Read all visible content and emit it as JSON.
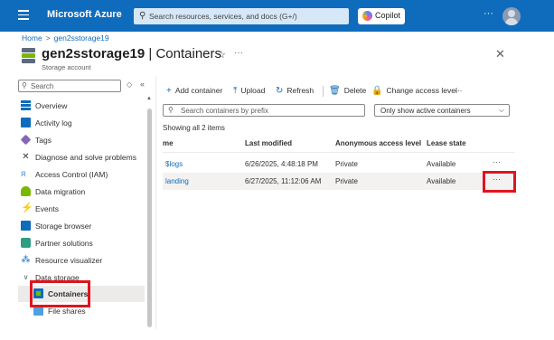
{
  "topbar": {
    "brand": "Microsoft Azure",
    "search_placeholder": "Search resources, services, and docs (G+/)",
    "copilot_label": "Copilot",
    "more": "···"
  },
  "breadcrumb": {
    "home": "Home",
    "separator": ">",
    "resource": "gen2sstorage19"
  },
  "header": {
    "resource_name": "gen2sstorage19",
    "page_name": "| Containers",
    "subtitle": "Storage account",
    "favorite_icon": "☆",
    "more": "···",
    "close": "✕"
  },
  "sidebar": {
    "search_placeholder": "Search",
    "options_icon": "◇",
    "collapse_icon": "«",
    "items": [
      {
        "label": "Overview",
        "icon": "overview-icon"
      },
      {
        "label": "Activity log",
        "icon": "activity-log-icon"
      },
      {
        "label": "Tags",
        "icon": "tags-icon"
      },
      {
        "label": "Diagnose and solve problems",
        "icon": "wrench-icon",
        "glyph": "✕"
      },
      {
        "label": "Access Control (IAM)",
        "icon": "people-icon",
        "glyph": "ᴙ"
      },
      {
        "label": "Data migration",
        "icon": "data-migration-icon"
      },
      {
        "label": "Events",
        "icon": "lightning-icon",
        "glyph": "⚡"
      },
      {
        "label": "Storage browser",
        "icon": "storage-browser-icon"
      },
      {
        "label": "Partner solutions",
        "icon": "partner-solutions-icon"
      },
      {
        "label": "Resource visualizer",
        "icon": "resource-visualizer-icon",
        "glyph": "⁂"
      },
      {
        "label": "Data storage",
        "icon": "chevron-down-icon",
        "glyph": "∨"
      },
      {
        "label": "Containers",
        "icon": "containers-icon",
        "active": true
      },
      {
        "label": "File shares",
        "icon": "file-shares-icon"
      }
    ]
  },
  "toolbar": {
    "add_container": "Add container",
    "upload": "Upload",
    "refresh": "Refresh",
    "delete": "Delete",
    "change_access_level": "Change access level",
    "more": "···"
  },
  "filter": {
    "search_placeholder": "Search containers by prefix",
    "select_value": "Only show active containers"
  },
  "showing_text": "Showing all 2 items",
  "table": {
    "columns": [
      "me",
      "Last modified",
      "Anonymous access level",
      "Lease state"
    ],
    "rows": [
      {
        "name": "$logs",
        "last_modified": "6/26/2025, 4:48:18 PM",
        "access": "Private",
        "lease": "Available",
        "more": "···"
      },
      {
        "name": "landing",
        "last_modified": "6/27/2025, 11:12:06 AM",
        "access": "Private",
        "lease": "Available",
        "more": "···"
      }
    ]
  },
  "colors": {
    "topbar": "#0f6cbd",
    "accent": "#0f6cbd",
    "highlight": "#e0141e"
  }
}
